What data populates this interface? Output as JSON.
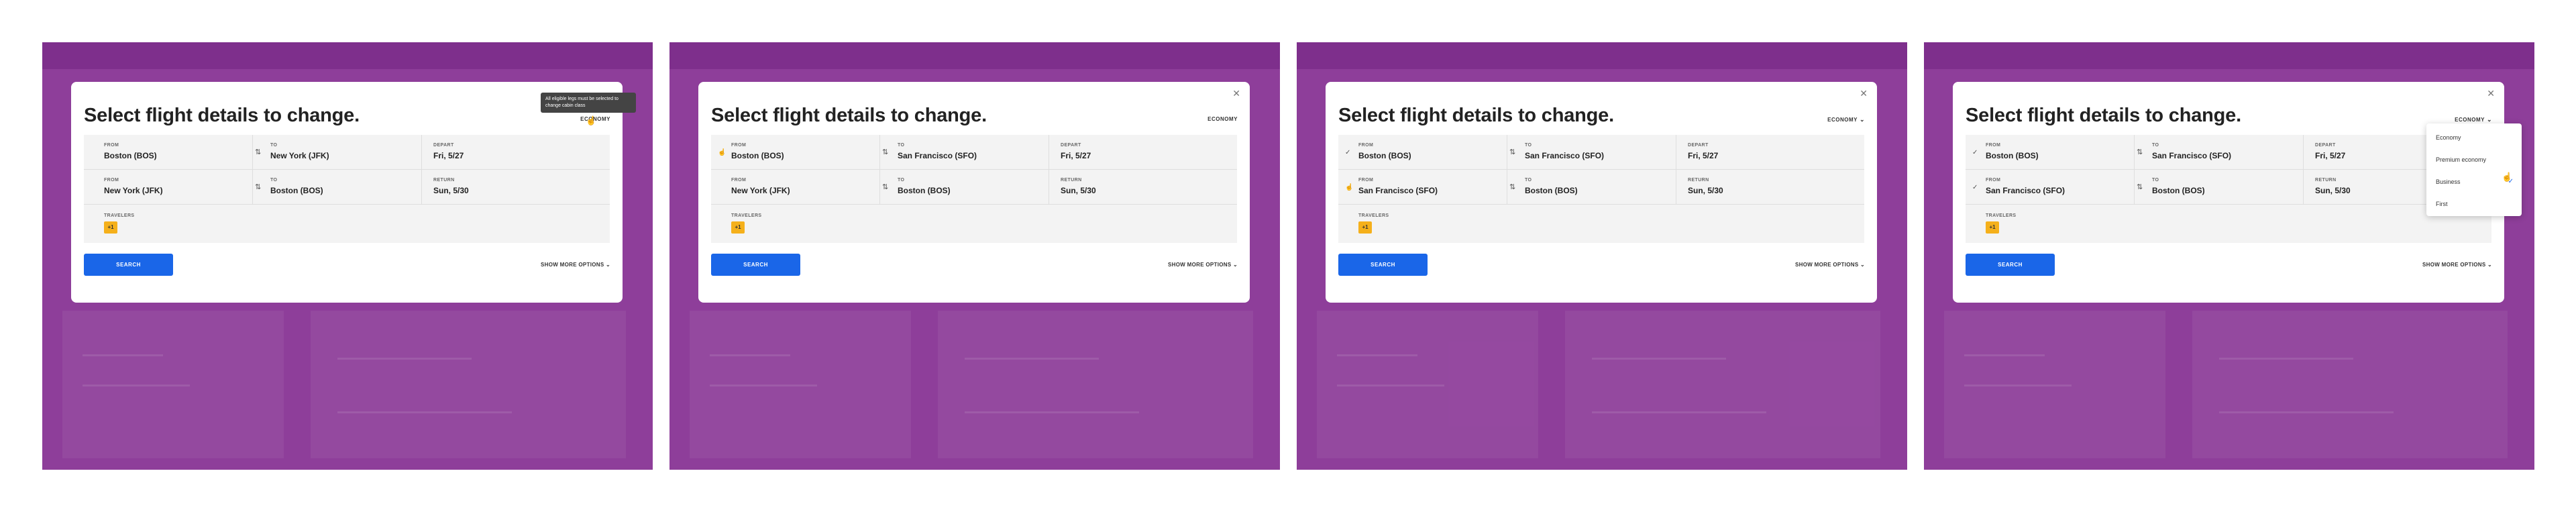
{
  "dialog": {
    "title": "Select flight details to change.",
    "close_icon": "close-icon",
    "labels": {
      "from": "FROM",
      "to": "TO",
      "depart": "DEPART",
      "return": "RETURN",
      "travelers": "TRAVELERS"
    },
    "search_label": "SEARCH",
    "more_options_label": "SHOW MORE OPTIONS"
  },
  "panels": [
    {
      "cabin_label": "ECONOMY",
      "tooltip": "All eligible legs must be selected to change cabin class",
      "trip": [
        {
          "from": "Boston (BOS)",
          "to": "New York (JFK)",
          "date_label": "DEPART",
          "date": "Fri, 5/27"
        },
        {
          "from": "New York (JFK)",
          "to": "Boston (BOS)",
          "date_label": "RETURN",
          "date": "Sun, 5/30"
        }
      ],
      "traveler_badge": "+1"
    },
    {
      "cabin_label": "ECONOMY",
      "trip": [
        {
          "from": "Boston (BOS)",
          "to": "San Francisco (SFO)",
          "date_label": "DEPART",
          "date": "Fri, 5/27"
        },
        {
          "from": "New York (JFK)",
          "to": "Boston (BOS)",
          "date_label": "RETURN",
          "date": "Sun, 5/30"
        }
      ],
      "traveler_badge": "+1"
    },
    {
      "cabin_label": "ECONOMY",
      "trip": [
        {
          "from": "Boston (BOS)",
          "to": "San Francisco (SFO)",
          "date_label": "DEPART",
          "date": "Fri, 5/27"
        },
        {
          "from": "San Francisco (SFO)",
          "to": "Boston (BOS)",
          "date_label": "RETURN",
          "date": "Sun, 5/30"
        }
      ],
      "traveler_badge": "+1"
    },
    {
      "cabin_label": "ECONOMY",
      "trip": [
        {
          "from": "Boston (BOS)",
          "to": "San Francisco (SFO)",
          "date_label": "DEPART",
          "date": "Fri, 5/27"
        },
        {
          "from": "San Francisco (SFO)",
          "to": "Boston (BOS)",
          "date_label": "RETURN",
          "date": "Sun, 5/30"
        }
      ],
      "traveler_badge": "+1",
      "cabin_options": [
        "Economy",
        "Premium economy",
        "Business",
        "First"
      ]
    }
  ],
  "colors": {
    "backdrop": "#8e3e9a",
    "accent": "#1a66e8",
    "badge": "#f5b01b"
  }
}
